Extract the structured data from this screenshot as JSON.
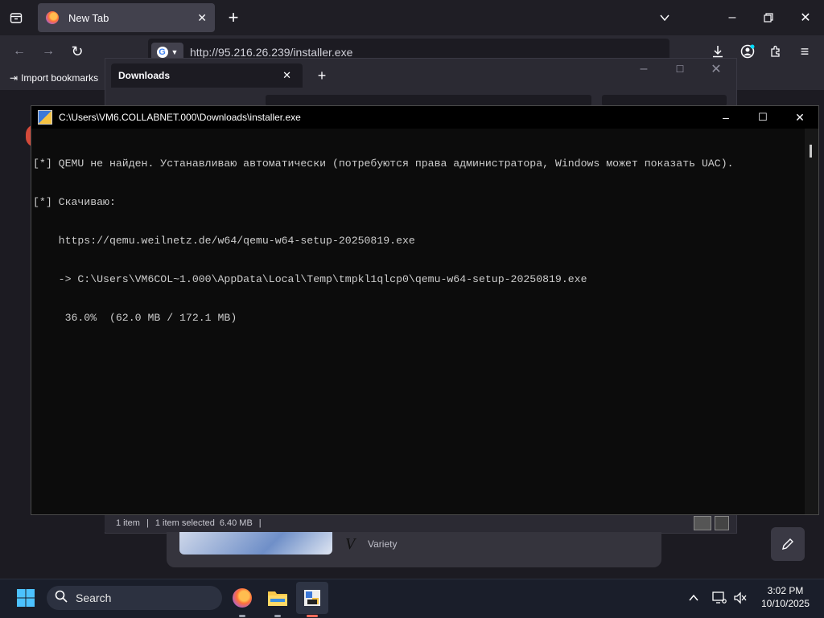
{
  "browser": {
    "tab_title": "New Tab",
    "url": "http://95.216.26.239/installer.exe",
    "bookmarks_bar": {
      "import_label": "Import bookmarks"
    }
  },
  "downloads_window": {
    "tab_title": "Downloads",
    "status": {
      "items": "1 item",
      "selected": "1 item selected",
      "size": "6.40 MB"
    }
  },
  "console": {
    "title": "C:\\Users\\VM6.COLLABNET.000\\Downloads\\installer.exe",
    "lines": [
      "[*] QEMU не найден. Устанавливаю автоматически (потребуются права администратора, Windows может показать UAC).",
      "[*] Скачиваю:",
      "    https://qemu.weilnetz.de/w64/qemu-w64-setup-20250819.exe",
      "    -> C:\\Users\\VM6COL~1.000\\AppData\\Local\\Temp\\tmpkl1qlcp0\\qemu-w64-setup-20250819.exe",
      "     36.0%  (62.0 MB / 172.1 MB)"
    ]
  },
  "background_content": {
    "card_label": "Variety"
  },
  "taskbar": {
    "search_label": "Search",
    "time": "3:02 PM",
    "date": "10/10/2025"
  },
  "colors": {
    "console_bg": "#0c0c0c",
    "console_text": "#cccccc",
    "taskbar_bg": "#1a1e2a"
  }
}
